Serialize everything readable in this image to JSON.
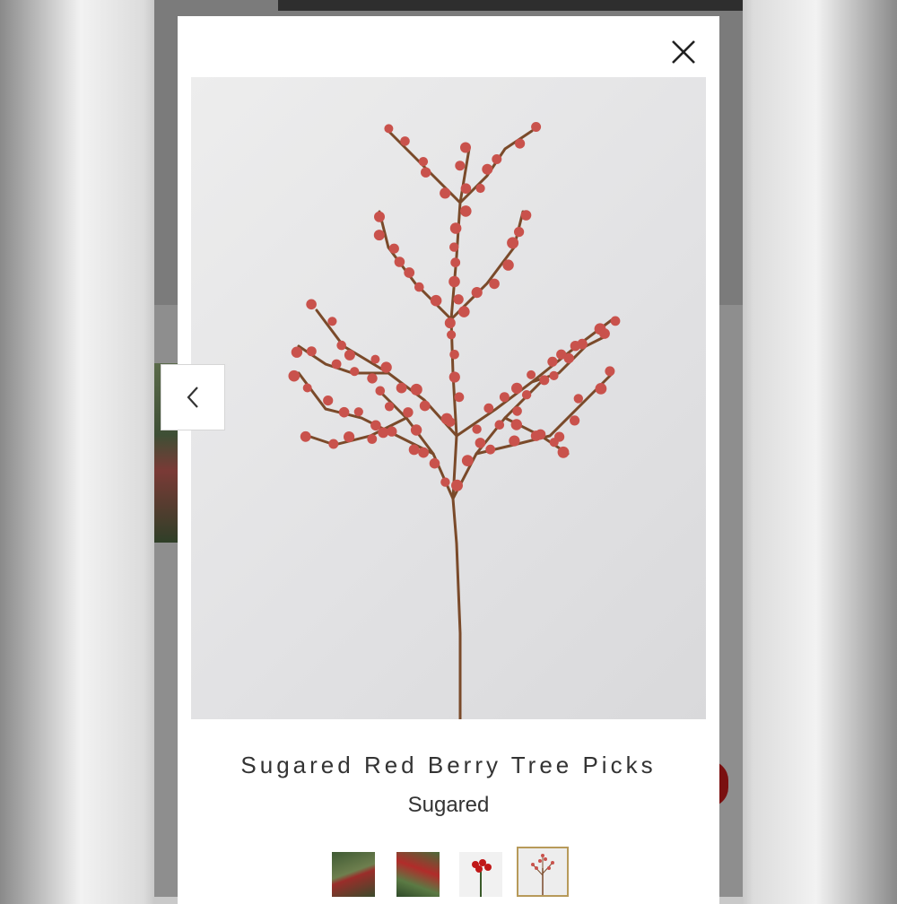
{
  "product": {
    "title": "Sugared Red Berry Tree Picks",
    "variant": "Sugared"
  },
  "icons": {
    "close": "close-icon",
    "previous": "chevron-left-icon"
  },
  "gallery": {
    "thumbnails": [
      {
        "name": "thumbnail-1"
      },
      {
        "name": "thumbnail-2"
      },
      {
        "name": "thumbnail-3"
      },
      {
        "name": "thumbnail-4",
        "selected": true
      }
    ]
  },
  "colors": {
    "selected_thumbnail_border": "#b79a5a",
    "berry": "#c9524c",
    "stem": "#7a4a2a"
  }
}
